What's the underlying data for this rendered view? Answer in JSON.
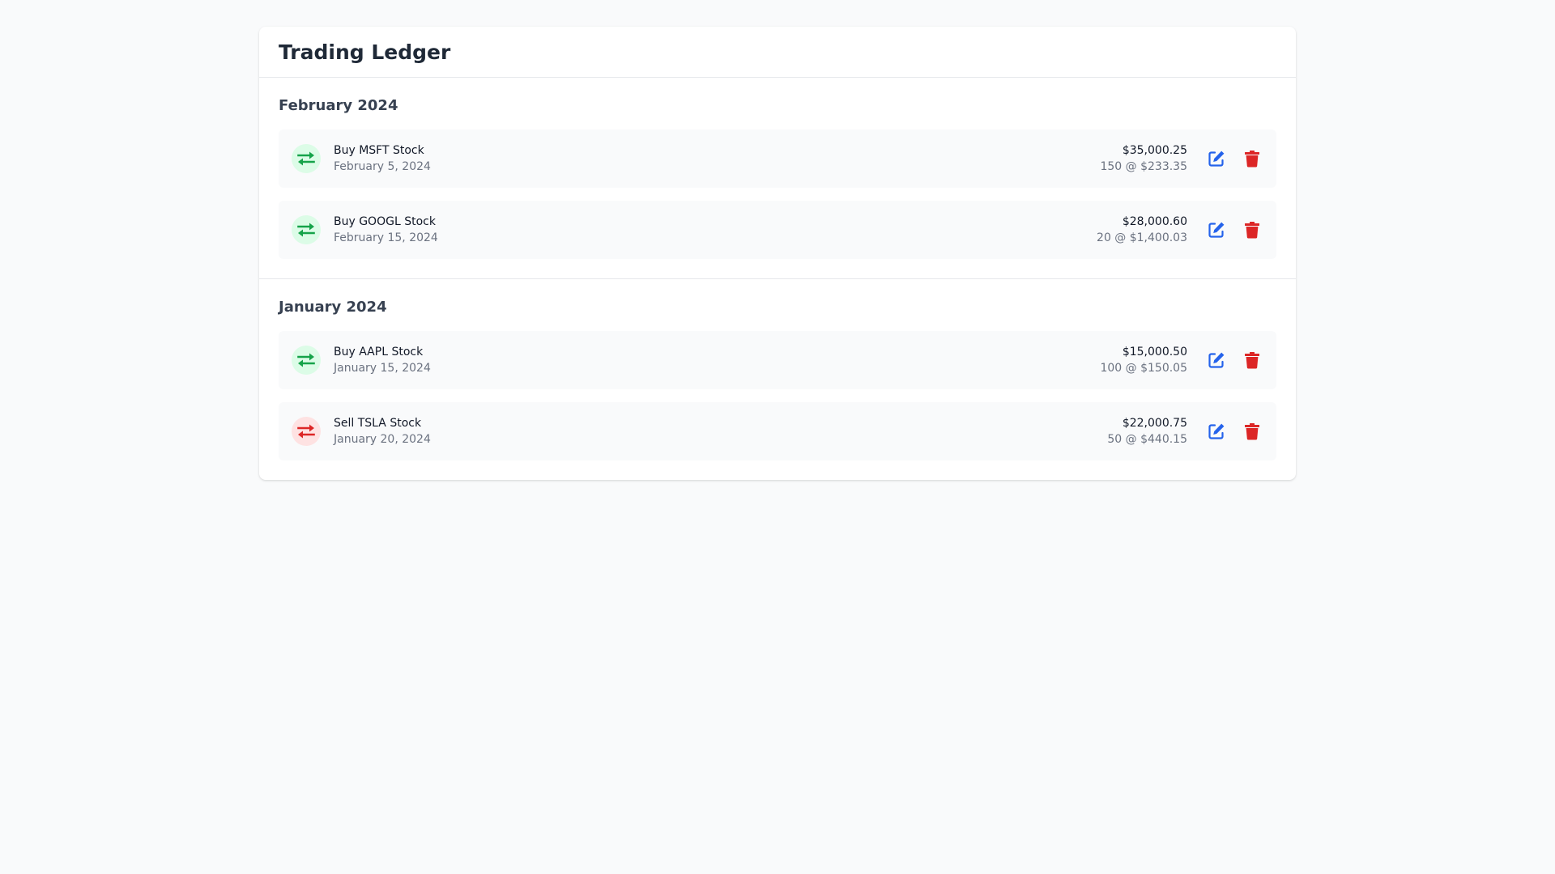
{
  "header": {
    "title": "Trading Ledger"
  },
  "colors": {
    "buy_icon": "#16a34a",
    "buy_icon_bg": "#dcfce7",
    "sell_icon": "#dc2626",
    "sell_icon_bg": "#fee2e2",
    "edit_icon": "#2563eb",
    "delete_icon": "#dc2626"
  },
  "months": [
    {
      "title": "February 2024",
      "transactions": [
        {
          "type": "buy",
          "icon": "exchange-arrows-icon",
          "name": "Buy MSFT Stock",
          "date": "February 5, 2024",
          "total": "$35,000.25",
          "detail": "150 @ $233.35"
        },
        {
          "type": "buy",
          "icon": "exchange-arrows-icon",
          "name": "Buy GOOGL Stock",
          "date": "February 15, 2024",
          "total": "$28,000.60",
          "detail": "20 @ $1,400.03"
        }
      ]
    },
    {
      "title": "January 2024",
      "transactions": [
        {
          "type": "buy",
          "icon": "exchange-arrows-icon",
          "name": "Buy AAPL Stock",
          "date": "January 15, 2024",
          "total": "$15,000.50",
          "detail": "100 @ $150.05"
        },
        {
          "type": "sell",
          "icon": "exchange-arrows-icon",
          "name": "Sell TSLA Stock",
          "date": "January 20, 2024",
          "total": "$22,000.75",
          "detail": "50 @ $440.15"
        }
      ]
    }
  ]
}
